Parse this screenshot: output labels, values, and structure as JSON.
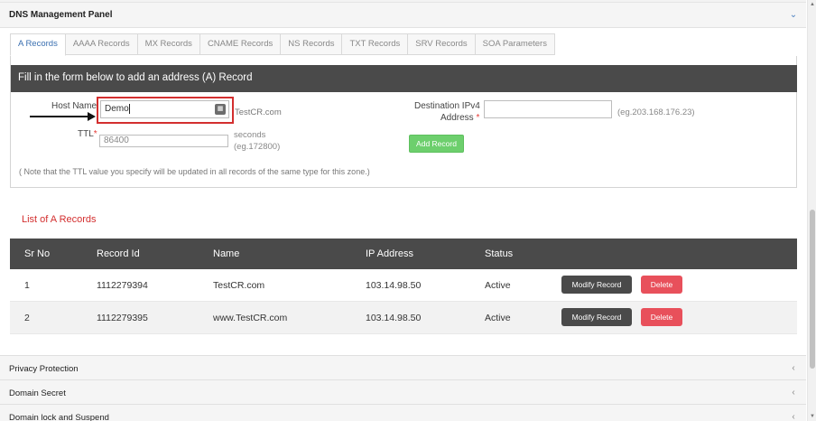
{
  "panel": {
    "title": "DNS Management Panel",
    "toggle_icon": "chevron-down-icon"
  },
  "tabs": [
    {
      "label": "A Records",
      "active": true
    },
    {
      "label": "AAAA Records",
      "active": false
    },
    {
      "label": "MX Records",
      "active": false
    },
    {
      "label": "CNAME Records",
      "active": false
    },
    {
      "label": "NS Records",
      "active": false
    },
    {
      "label": "TXT Records",
      "active": false
    },
    {
      "label": "SRV Records",
      "active": false
    },
    {
      "label": "SOA Parameters",
      "active": false
    }
  ],
  "form": {
    "heading": "Fill in the form below to add an address (A) Record",
    "host_label": "Host Name",
    "host_value": "Demo",
    "host_suffix": "TestCR.com",
    "ttl_label": "TTL",
    "ttl_required": "*",
    "ttl_placeholder": "86400",
    "ttl_unit": "seconds",
    "ttl_example": "(eg.172800)",
    "dest_label_line1": "Destination IPv4",
    "dest_label_line2": "Address",
    "dest_required": "*",
    "dest_value": "",
    "dest_example": "(eg.203.168.176.23)",
    "add_button": "Add Record",
    "note": "( Note that the TTL value you specify will be updated in all records of the same type for this zone.)"
  },
  "list": {
    "title": "List of A Records",
    "columns": [
      "Sr No",
      "Record Id",
      "Name",
      "IP Address",
      "Status"
    ],
    "rows": [
      {
        "sr": "1",
        "id": "1112279394",
        "name": "TestCR.com",
        "ip": "103.14.98.50",
        "status": "Active"
      },
      {
        "sr": "2",
        "id": "1112279395",
        "name": "www.TestCR.com",
        "ip": "103.14.98.50",
        "status": "Active"
      }
    ],
    "modify_label": "Modify Record",
    "delete_label": "Delete"
  },
  "accordions": [
    {
      "label": "Privacy Protection"
    },
    {
      "label": "Domain Secret"
    },
    {
      "label": "Domain lock and Suspend"
    }
  ],
  "colors": {
    "header_dark": "#4a4a4a",
    "accent_red": "#d32f2f",
    "add_green": "#6dcf6d",
    "delete_red": "#e8505b",
    "tab_active": "#3a6fb0"
  }
}
